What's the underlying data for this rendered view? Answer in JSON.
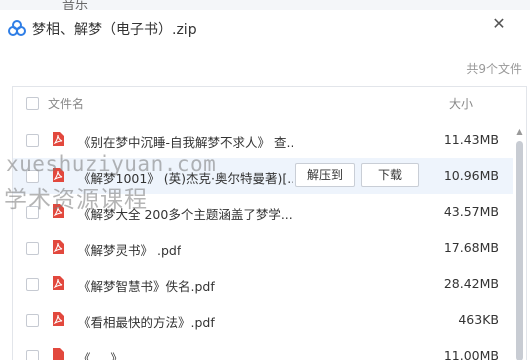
{
  "background": {
    "label": "音乐"
  },
  "window": {
    "title": "梦相、解梦（电子书）.zip",
    "close_glyph": "✕"
  },
  "summary": {
    "count": "共9个文件"
  },
  "table": {
    "headers": {
      "name": "文件名",
      "size": "大小"
    },
    "rows": [
      {
        "name": "《别在梦中沉睡-自我解梦不求人》 查...",
        "size": "11.43MB"
      },
      {
        "name": "《解梦1001》 (英)杰克·奥尔特曼著)[...",
        "size": "10.96MB"
      },
      {
        "name": "《解梦大全 200多个主题涵盖了梦学...",
        "size": "43.57MB"
      },
      {
        "name": "《解梦灵书》 .pdf",
        "size": "17.68MB"
      },
      {
        "name": "《解梦智慧书》佚名.pdf",
        "size": "28.42MB"
      },
      {
        "name": "《看相最快的方法》.pdf",
        "size": "463KB"
      },
      {
        "name": "《 ... 》",
        "size": "11.00MB"
      }
    ]
  },
  "actions": {
    "extract": "解压到",
    "download": "下载"
  },
  "watermark": {
    "line1": "xueshuziyuan.com",
    "line2": "学术资源课程"
  },
  "colors": {
    "pdf_red": "#e2483d",
    "hover_row": "#eef4fc",
    "cloud_blue": "#2f7ee6"
  }
}
